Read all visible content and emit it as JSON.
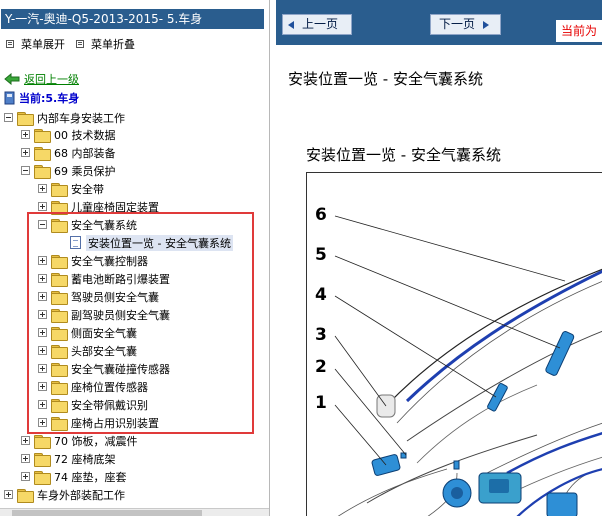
{
  "left_panel": {
    "title": "Y-一汽-奥迪-Q5-2013-2015- 5.车身",
    "expand_all": "菜单展开",
    "collapse_all": "菜单折叠",
    "back": "返回上一级",
    "current": "当前:5.车身"
  },
  "tree": {
    "root": "内部车身安装工作",
    "n00": "00 技术数据",
    "n68": "68 内部装备",
    "n69": "69 乘员保护",
    "seatbelt": "安全带",
    "child_seat": "儿童座椅固定装置",
    "airbag_system": "安全气囊系统",
    "airbag_overview": "安装位置一览 - 安全气囊系统",
    "airbag_controller": "安全气囊控制器",
    "battery_disconnect": "蓄电池断路引爆装置",
    "driver_airbag": "驾驶员侧安全气囊",
    "passenger_airbag": "副驾驶员侧安全气囊",
    "side_airbag": "侧面安全气囊",
    "head_airbag": "头部安全气囊",
    "crash_sensor": "安全气囊碰撞传感器",
    "seat_position_sensor": "座椅位置传感器",
    "belt_recognition": "安全带佩戴识别",
    "seat_occupancy": "座椅占用识别装置",
    "n70": "70 饰板，减震件",
    "n72": "72 座椅底架",
    "n74": "74 座垫，座套",
    "exterior": "车身外部装配工作"
  },
  "nav": {
    "prev": "上一页",
    "next": "下一页",
    "current_tab": "当前为"
  },
  "content": {
    "page_title": "安装位置一览 - 安全气囊系统",
    "section_title": "安装位置一览 - 安全气囊系统",
    "callouts": [
      "6",
      "5",
      "4",
      "3",
      "2",
      "1"
    ]
  },
  "colors": {
    "title_bar": "#2a5d8e",
    "highlight_border": "#e03a3a",
    "back_link": "#008000",
    "current_label": "#0000cc",
    "current_tab_text": "#e60000",
    "wire_blue": "#1e3fb0",
    "component_blue": "#2e8fd6"
  },
  "icons": {
    "back": "green-left-arrow-icon",
    "book": "book-icon",
    "folder": "folder-icon",
    "document": "document-icon",
    "prev": "left-arrow-icon",
    "next": "right-arrow-icon"
  }
}
